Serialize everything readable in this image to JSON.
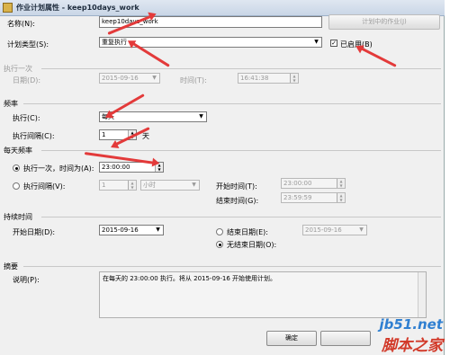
{
  "window": {
    "title": "作业计划属性 - keep10days_work"
  },
  "name": {
    "label": "名称(N):",
    "value": "keep10days_work",
    "jobs_button": "计划中的作业(J)"
  },
  "schedule_type": {
    "label": "计划类型(S):",
    "value": "重复执行",
    "enabled_label": "已启用(B)",
    "enabled": true
  },
  "one_time": {
    "header": "执行一次",
    "date_label": "日期(D):",
    "date_value": "2015-09-16",
    "time_label": "时间(T):",
    "time_value": "16:41:38"
  },
  "frequency": {
    "header": "频率",
    "occurs_label": "执行(C):",
    "occurs_value": "每天",
    "recurs_label": "执行间隔(C):",
    "recurs_value": "1",
    "recurs_unit": "天"
  },
  "daily": {
    "header": "每天频率",
    "once_label": "执行一次，时间为(A):",
    "once_value": "23:00:00",
    "every_label": "执行间隔(V):",
    "every_value": "1",
    "every_unit": "小时",
    "start_label": "开始时间(T):",
    "start_value": "23:00:00",
    "end_label": "结束时间(G):",
    "end_value": "23:59:59"
  },
  "duration": {
    "header": "持续时间",
    "start_label": "开始日期(D):",
    "start_value": "2015-09-16",
    "end_label": "结束日期(E):",
    "end_value": "2015-09-16",
    "no_end_label": "无结束日期(O):"
  },
  "summary": {
    "header": "摘要",
    "desc_label": "说明(P):",
    "desc_value": "在每天的 23:00:00 执行。将从 2015-09-16 开始使用计划。"
  },
  "footer": {
    "ok_label": "确定"
  },
  "watermark": {
    "line1": "jb51.net",
    "line2": "脚本之家"
  },
  "colors": {
    "annotation": "#e33a3a",
    "watermark_top": "#2f7fd1",
    "watermark_bottom": "#d23a2a"
  }
}
